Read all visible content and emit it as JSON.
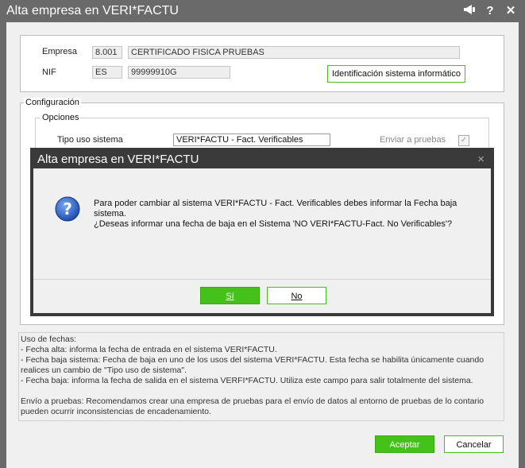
{
  "window": {
    "title": "Alta empresa en VERI*FACTU",
    "icons": [
      "megaphone-icon",
      "help-icon",
      "close-icon"
    ]
  },
  "top": {
    "empresa_label": "Empresa",
    "empresa_code": "8.001",
    "empresa_name": "CERTIFICADO FISICA PRUEBAS",
    "nif_label": "NIF",
    "nif_country": "ES",
    "nif_value": "99999910G",
    "ident_button": "Identificación sistema informático"
  },
  "config": {
    "legend": "Configuración",
    "opciones_legend": "Opciones",
    "tipo_label": "Tipo uso sistema",
    "tipo_value": "VERI*FACTU - Fact. Verificables",
    "enviar_label": "Enviar a pruebas",
    "enviar_checked": true
  },
  "info": {
    "lines": [
      "Uso de fechas:",
      " - Fecha alta: informa la fecha de entrada en el sistema VERI*FACTU.",
      " - Fecha baja sistema: Fecha de baja en uno de los usos del sistema VERI*FACTU. Esta fecha se  habilita únicamente cuando",
      "realices un cambio de \"Tipo uso de sistema\".",
      " - Fecha baja: informa la fecha de salida en el sistema VERFI*FACTU. Utiliza este campo para salir totalmente del sistema.",
      "",
      "Envío a pruebas: Recomendamos crear una empresa de pruebas para el envío de datos al entorno de pruebas de lo contario",
      "pueden ocurrir inconsistencias de encadenamiento."
    ]
  },
  "footer": {
    "accept": "Aceptar",
    "cancel": "Cancelar"
  },
  "dialog": {
    "title": "Alta empresa en VERI*FACTU",
    "close": "×",
    "message_lines": [
      "Para poder cambiar al sistema VERI*FACTU - Fact. Verificables debes informar la  Fecha baja",
      "sistema.",
      "¿Deseas informar una fecha de baja en el Sistema 'NO VERI*FACTU-Fact. No Verificables'?"
    ],
    "yes": "Sí",
    "no": "No"
  },
  "colors": {
    "accent_green": "#44c21a",
    "title_bg": "#6a6a6a",
    "dialog_bg": "#3a3a3a"
  }
}
